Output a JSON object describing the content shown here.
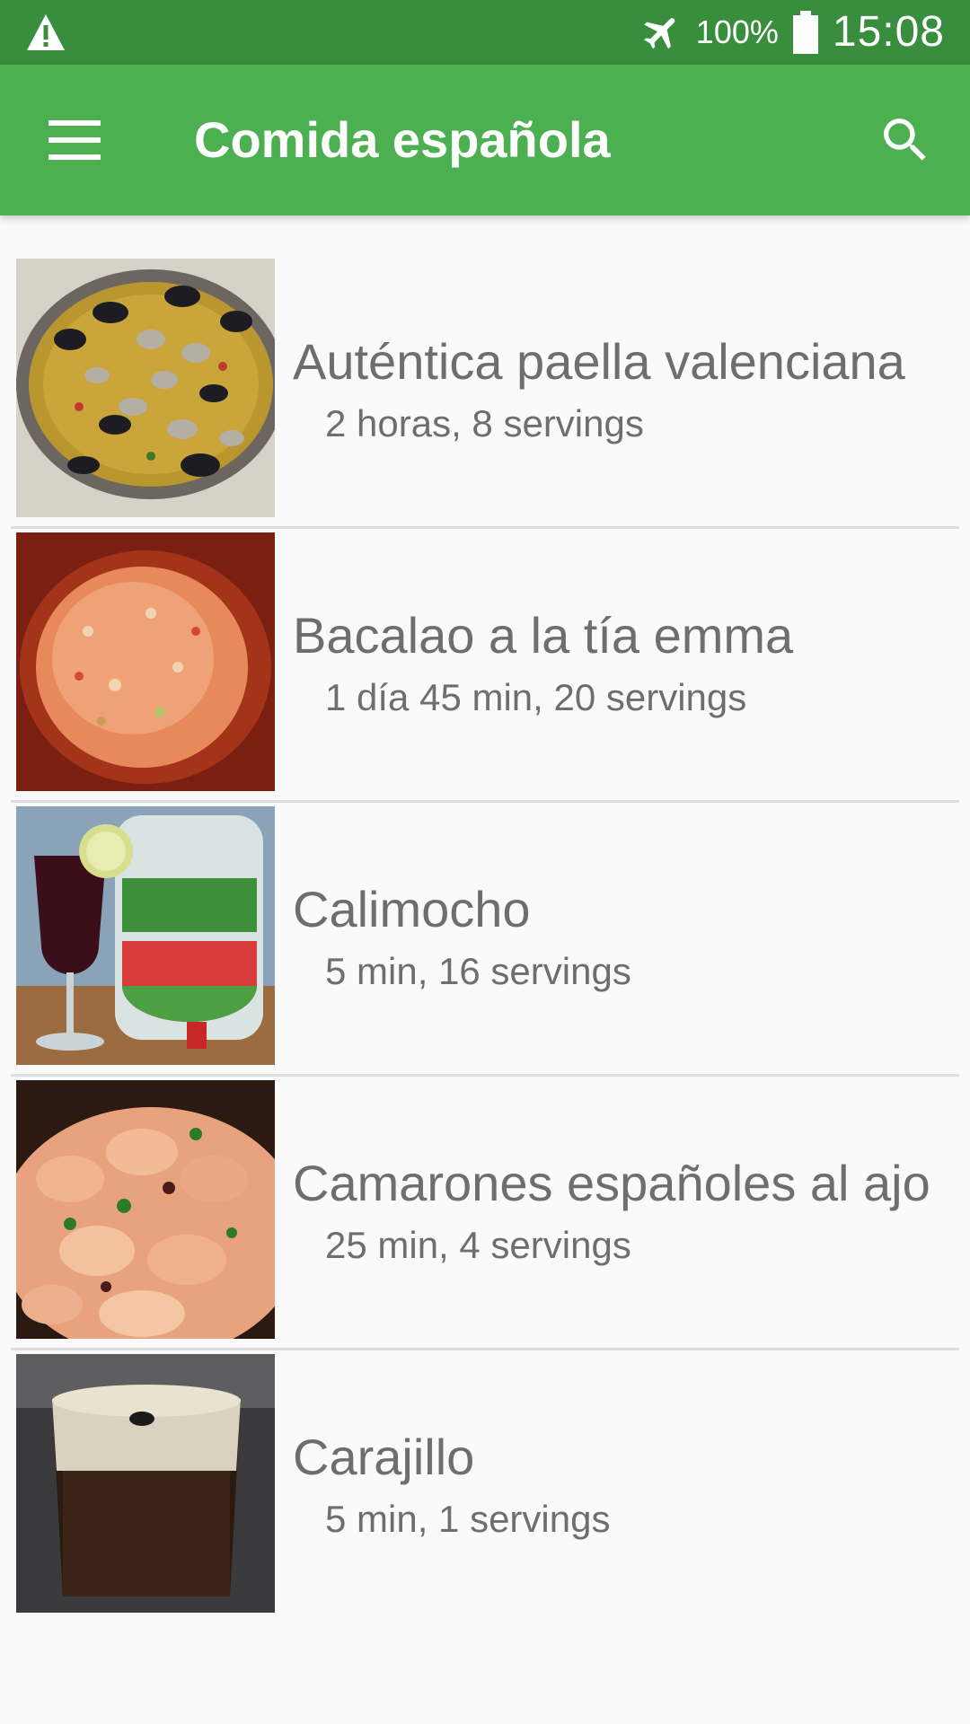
{
  "status_bar": {
    "battery_percent": "100%",
    "time": "15:08",
    "icons": [
      "warning-icon",
      "airplane-mode-icon",
      "battery-icon"
    ]
  },
  "app_bar": {
    "title": "Comida española",
    "icons": [
      "menu-icon",
      "search-icon"
    ]
  },
  "colors": {
    "status_bar": "#388E3C",
    "app_bar": "#4CAF50",
    "background": "#FAFAFA",
    "text": "#6E6E6E",
    "divider": "#DDDDDD"
  },
  "recipes": [
    {
      "name": "Auténtica paella valenciana",
      "meta": "2 horas, 8 servings",
      "image": "paella-photo"
    },
    {
      "name": "Bacalao a la tía emma",
      "meta": "1 día 45 min, 20 servings",
      "image": "bacalao-photo"
    },
    {
      "name": "Calimocho",
      "meta": "5 min, 16 servings",
      "image": "calimocho-photo"
    },
    {
      "name": "Camarones españoles al ajo",
      "meta": "25 min, 4 servings",
      "image": "camarones-photo"
    },
    {
      "name": "Carajillo",
      "meta": "5 min, 1 servings",
      "image": "carajillo-photo"
    }
  ]
}
